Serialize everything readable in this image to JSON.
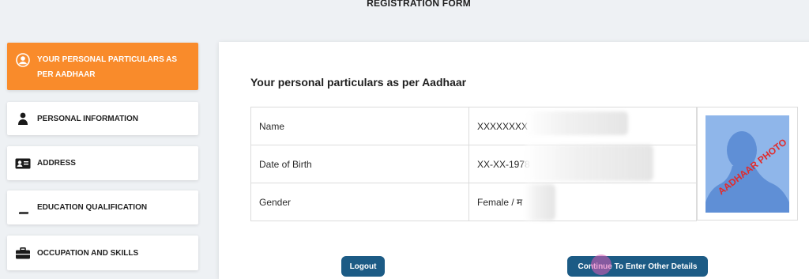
{
  "page_title": "REGISTRATION FORM",
  "sidebar": {
    "items": [
      {
        "label": "YOUR PERSONAL PARTICULARS AS PER AADHAAR",
        "icon": "user-circle-icon",
        "active": true
      },
      {
        "label": "PERSONAL INFORMATION",
        "icon": "person-icon",
        "active": false
      },
      {
        "label": "ADDRESS",
        "icon": "id-card-icon",
        "active": false
      },
      {
        "label": "EDUCATION QUALIFICATION",
        "icon": "book-icon",
        "active": false
      },
      {
        "label": "OCCUPATION AND SKILLS",
        "icon": "briefcase-icon",
        "active": false
      }
    ]
  },
  "main": {
    "heading": "Your personal particulars as per Aadhaar",
    "rows": [
      {
        "label": "Name",
        "value": "XXXXXXXX"
      },
      {
        "label": "Date of Birth",
        "value": "XX-XX-1978"
      },
      {
        "label": "Gender",
        "value": "Female / म"
      }
    ],
    "photo_stamp": "AADHAAR PHOTO",
    "buttons": {
      "logout": "Logout",
      "continue": "Continue To Enter Other Details"
    }
  },
  "colors": {
    "active_tab": "#f98b2b",
    "button": "#1c5b85",
    "photo_bg": "#8fb6ea",
    "stamp": "#e22b2b"
  }
}
